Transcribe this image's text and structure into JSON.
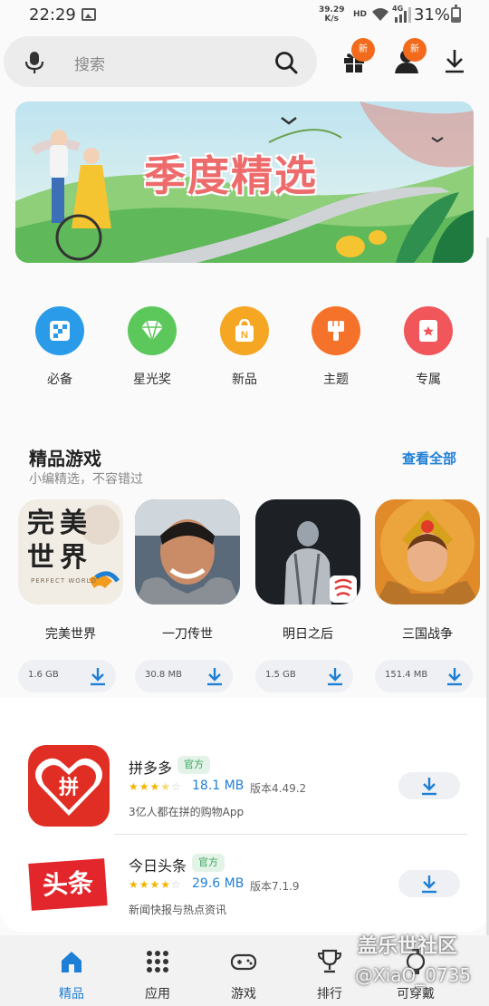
{
  "status_bar": {
    "time": "22:29",
    "net_speed_value": "39.29",
    "net_speed_unit": "K/s",
    "hd": "HD",
    "network": "4G",
    "battery": "31%",
    "battery_level": 0.31
  },
  "search": {
    "placeholder": "搜索"
  },
  "header": {
    "gift_badge": "新",
    "user_badge": "新"
  },
  "banner": {
    "title": "季度精选"
  },
  "categories": [
    {
      "label": "必备",
      "color": "#2a9be8",
      "icon": "flag-icon"
    },
    {
      "label": "星光奖",
      "color": "#5cc85c",
      "icon": "diamond-icon"
    },
    {
      "label": "新品",
      "color": "#f5a623",
      "icon": "new-bag-icon"
    },
    {
      "label": "主题",
      "color": "#f5722b",
      "icon": "brush-icon"
    },
    {
      "label": "专属",
      "color": "#f0565a",
      "icon": "star-card-icon"
    }
  ],
  "featured_games": {
    "title": "精品游戏",
    "subtitle": "小编精选，不容错过",
    "view_all": "查看全部",
    "items": [
      {
        "name": "完美世界",
        "size": "1.6 GB",
        "icon_title": "完美世界",
        "icon_sub": "PERFECT WORLD"
      },
      {
        "name": "一刀传世",
        "size": "30.8 MB"
      },
      {
        "name": "明日之后",
        "size": "1.5 GB"
      },
      {
        "name": "三国战争",
        "size": "151.4 MB"
      }
    ]
  },
  "apps": [
    {
      "name": "拼多多",
      "tag": "官方",
      "rating": 3.5,
      "size": "18.1 MB",
      "version": "版本4.49.2",
      "desc": "3亿人都在拼的购物App",
      "icon_text": "拼"
    },
    {
      "name": "今日头条",
      "tag": "官方",
      "rating": 4,
      "size": "29.6 MB",
      "version": "版本7.1.9",
      "desc": "新闻快报与热点资讯",
      "icon_text": "头条"
    }
  ],
  "bottom_nav": [
    {
      "label": "精品",
      "icon": "home-icon",
      "active": true
    },
    {
      "label": "应用",
      "icon": "apps-grid-icon",
      "active": false
    },
    {
      "label": "游戏",
      "icon": "gamepad-icon",
      "active": false
    },
    {
      "label": "排行",
      "icon": "trophy-icon",
      "active": false
    },
    {
      "label": "可穿戴",
      "icon": "wearable-icon",
      "active": false
    }
  ],
  "watermark": {
    "line1": "盖乐世社区",
    "line2": "@XiaO_0735"
  },
  "colors": {
    "accent": "#1e7fd6",
    "badge": "#f26a1b",
    "official_tag_bg": "#e3f3e7",
    "official_tag_fg": "#38a55d"
  }
}
